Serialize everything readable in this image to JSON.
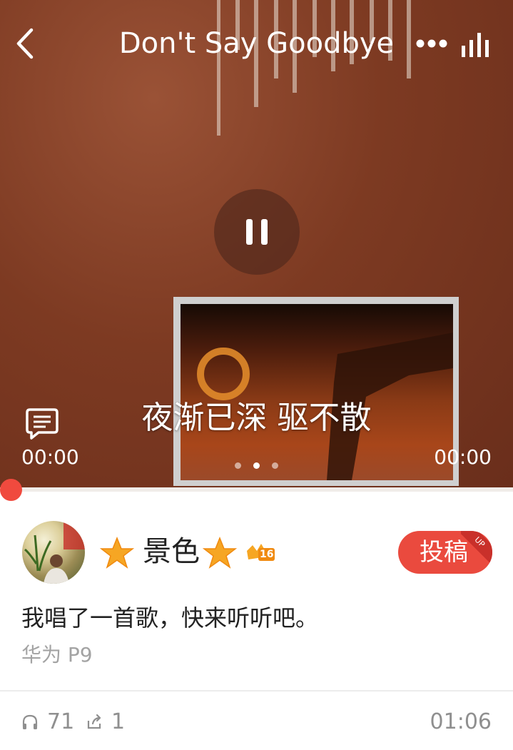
{
  "player": {
    "title": "Don't Say Goodbye",
    "lyric": "夜渐已深 驱不散",
    "time_elapsed": "00:00",
    "time_total": "00:00",
    "progress": 0,
    "page_indicator": {
      "count": 3,
      "active": 1
    },
    "icons": [
      "back-arrow-icon",
      "more-dots-icon",
      "equalizer-icon",
      "pause-icon",
      "lyrics-comment-icon"
    ]
  },
  "post": {
    "username": "景色",
    "level_badge": "16",
    "submit_label": "投稿",
    "submit_corner": "UP",
    "text": "我唱了一首歌，快来听听吧。",
    "device": "华为 P9"
  },
  "stats": {
    "listens": "71",
    "shares": "1",
    "duration": "01:06"
  },
  "colors": {
    "accent": "#ea4a3e",
    "player_bg": "#7d3a22",
    "gold_star": "#f6a623"
  }
}
